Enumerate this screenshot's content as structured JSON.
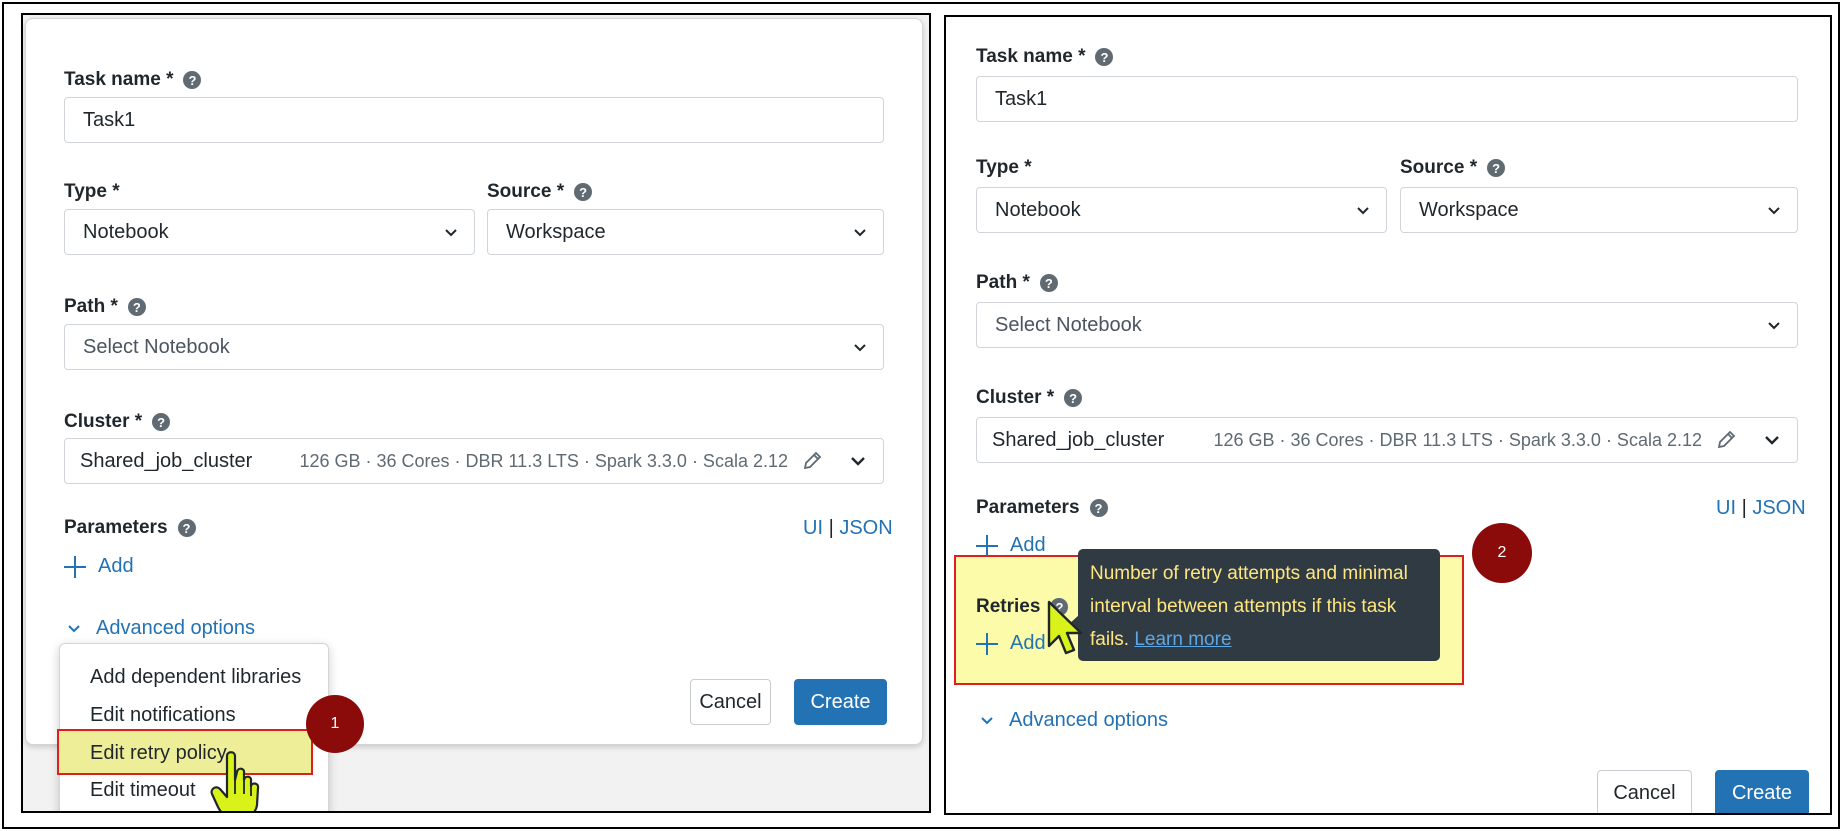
{
  "shared": {
    "task_name_label": "Task name *",
    "task_name_value": "Task1",
    "type_label": "Type *",
    "type_value": "Notebook",
    "source_label": "Source *",
    "source_value": "Workspace",
    "path_label": "Path *",
    "path_placeholder": "Select Notebook",
    "cluster_label": "Cluster *",
    "cluster_name": "Shared_job_cluster",
    "cluster_meta": "126 GB · 36 Cores · DBR 11.3 LTS · Spark 3.3.0 · Scala 2.12",
    "parameters_label": "Parameters",
    "ui_toggle": "UI",
    "separator": "|",
    "json_toggle": "JSON",
    "add_label": "Add",
    "advanced_options": "Advanced options",
    "cancel": "Cancel",
    "create": "Create",
    "help_glyph": "?"
  },
  "left_panel": {
    "dropdown_items": [
      "Add dependent libraries",
      "Edit notifications",
      "Edit retry policy",
      "Edit timeout"
    ],
    "highlighted_item": "Edit retry policy",
    "step_badge": "1",
    "cursor": "hand-pointer-icon"
  },
  "right_panel": {
    "retries_label": "Retries",
    "tooltip_text": "Number of retry attempts and minimal interval between attempts if this task fails.",
    "tooltip_link": "Learn more",
    "step_badge": "2",
    "cursor": "arrow-pointer-icon"
  },
  "colors": {
    "accent": "#2272b4",
    "highlight_fill": "#eeee99",
    "highlight_border": "#e01e1e",
    "badge": "#8b0a0a",
    "tooltip_bg": "#2f3a42",
    "tooltip_text": "#ffe680",
    "cursor_fill": "#d9f21a"
  }
}
